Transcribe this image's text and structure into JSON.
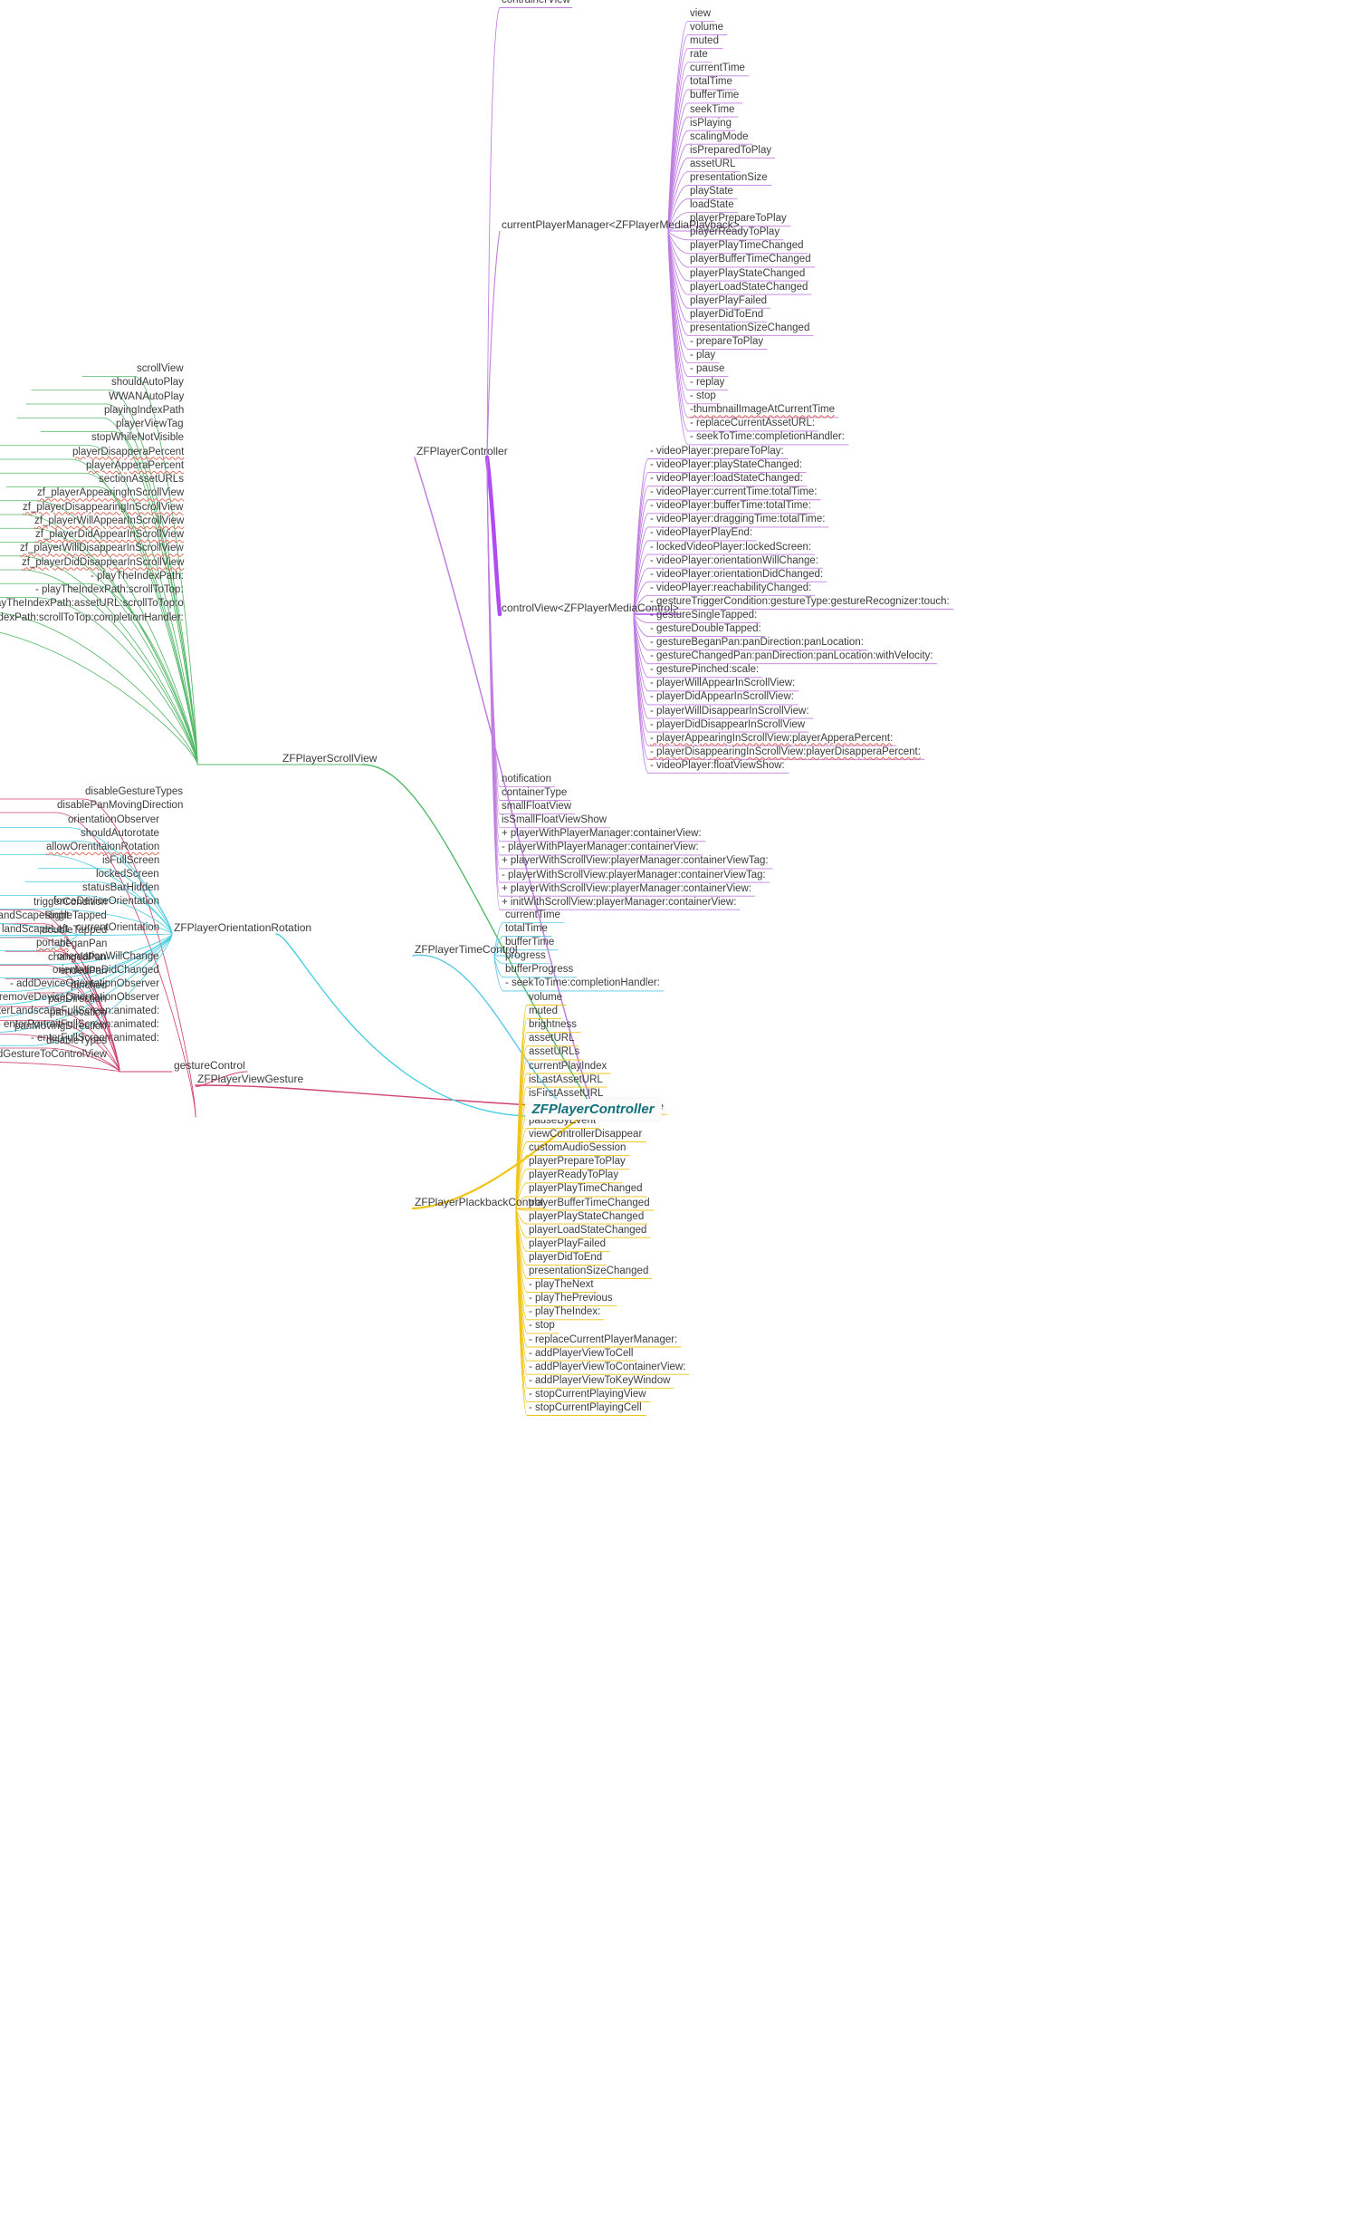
{
  "diagram": {
    "type": "mindmap",
    "title": "ZFPlayerController",
    "root": {
      "label": "ZFPlayerController",
      "color": "#11707c"
    },
    "colors": {
      "scrollview": "#55b869",
      "gesture": "#d0446f",
      "orientation": "#49cfe0",
      "manager": "#c07fe0",
      "controlview": "#a12df0",
      "timecontrol": "#5bc8e8",
      "playback": "#f0c419",
      "text": "#3c3c3c",
      "spellcheck": "#e06a5a"
    },
    "branches": [
      {
        "id": "scrollview",
        "label": "ZFPlayerScrollView",
        "color": "#55b869",
        "side": "left",
        "items": [
          {
            "label": "scrollView",
            "spell": false
          },
          {
            "label": "shouldAutoPlay",
            "spell": false
          },
          {
            "label": "WWANAutoPlay",
            "spell": false
          },
          {
            "label": "playingIndexPath",
            "spell": false
          },
          {
            "label": "playerViewTag",
            "spell": false
          },
          {
            "label": "stopWhileNotVisible",
            "spell": false
          },
          {
            "label": "playerDisapperaPercent",
            "spell": true
          },
          {
            "label": "playerApperaPercent",
            "spell": true
          },
          {
            "label": "sectionAssetURLs",
            "spell": false
          },
          {
            "label": "zf_playerAppearingInScrollView",
            "spell": true
          },
          {
            "label": "zf_playerDisappearingInScrollView",
            "spell": true
          },
          {
            "label": "zf_playerWillAppearInScrollView",
            "spell": true
          },
          {
            "label": "zf_playerDidAppearInScrollView",
            "spell": true
          },
          {
            "label": "zf_playerWillDisappearInScrollView",
            "spell": true
          },
          {
            "label": "zf_playerDidDisappearInScrollView",
            "spell": true
          },
          {
            "label": "- playTheIndexPath:",
            "spell": false
          },
          {
            "label": "- playTheIndexPath:scrollToTop:",
            "spell": false
          },
          {
            "label": "- playTheIndexPath:assetURL:scrollToTop:o",
            "spell": false
          },
          {
            "label": "- playTheIndexPath:scrollToTop:completionHandler:",
            "spell": false
          }
        ]
      },
      {
        "id": "gesture",
        "label": "ZFPlayerViewGesture",
        "color": "#d0446f",
        "side": "left",
        "subgroup": {
          "label": "gestureControl",
          "items": [
            {
              "label": "triggerCondition",
              "spell": false
            },
            {
              "label": "singleTapped",
              "spell": false
            },
            {
              "label": "doubleTapped",
              "spell": false
            },
            {
              "label": "beganPan",
              "spell": false
            },
            {
              "label": "changedPan",
              "spell": false
            },
            {
              "label": "endedPan",
              "spell": false
            },
            {
              "label": "pinched",
              "spell": false
            },
            {
              "label": "panDirection",
              "spell": false
            },
            {
              "label": "panLocation",
              "spell": false
            },
            {
              "label": "panMovingDirection",
              "spell": false
            },
            {
              "label": "disableTypes",
              "spell": false
            },
            {
              "label": "- addGestureToControlView",
              "spell": false
            }
          ]
        },
        "items": [
          {
            "label": "disableGestureTypes",
            "spell": false
          },
          {
            "label": "disablePanMovingDirection",
            "spell": false
          }
        ]
      },
      {
        "id": "orientation",
        "label": "ZFPlayerOrientationRotation",
        "color": "#49cfe0",
        "side": "left",
        "items": [
          {
            "label": "orientationObserver",
            "spell": false
          },
          {
            "label": "shouldAutorotate",
            "spell": false
          },
          {
            "label": "allowOrentitaionRotation",
            "spell": true
          },
          {
            "label": "isFullScreen",
            "spell": false
          },
          {
            "label": "lockedScreen",
            "spell": false
          },
          {
            "label": "statusBarHidden",
            "spell": false
          },
          {
            "label": "forceDeviceOrientation",
            "spell": false
          },
          {
            "label": "currentOrientation",
            "spell": false
          },
          {
            "label": "orientationWillChange",
            "spell": false
          },
          {
            "label": "orientationDidChanged",
            "spell": false
          },
          {
            "label": "- addDeviceOrientationObserver",
            "spell": false
          },
          {
            "label": "- removeDeviceOrientationObserver",
            "spell": false
          },
          {
            "label": "- enterLandscapeFullScreen:animated:",
            "spell": false
          },
          {
            "label": "- enterPortraitFullScreen:animated:",
            "spell": false
          },
          {
            "label": "- enterFullScreen:animated:",
            "spell": false
          }
        ],
        "subgroup2": {
          "label": "currentOrientation",
          "items": [
            {
              "label": "landScapeRight",
              "spell": false
            },
            {
              "label": "landScapeLeft",
              "spell": false
            },
            {
              "label": "portarit",
              "spell": true
            }
          ]
        }
      },
      {
        "id": "controller",
        "label": "ZFPlayerController",
        "color": "#c07fe0",
        "side": "right",
        "items": [
          {
            "label": "contrainerView",
            "spell": false
          }
        ],
        "managerNode": {
          "label": "currentPlayerManager<ZFPlayerMediaPlayback>",
          "items": [
            {
              "label": "view",
              "spell": false
            },
            {
              "label": "volume",
              "spell": false
            },
            {
              "label": "muted",
              "spell": false
            },
            {
              "label": "rate",
              "spell": false
            },
            {
              "label": "currentTime",
              "spell": false
            },
            {
              "label": "totalTime",
              "spell": false
            },
            {
              "label": "bufferTime",
              "spell": false
            },
            {
              "label": "seekTime",
              "spell": false
            },
            {
              "label": "isPlaying",
              "spell": false
            },
            {
              "label": "scalingMode",
              "spell": false
            },
            {
              "label": "isPreparedToPlay",
              "spell": false
            },
            {
              "label": "assetURL",
              "spell": false
            },
            {
              "label": "presentationSize",
              "spell": false
            },
            {
              "label": "playState",
              "spell": false
            },
            {
              "label": "loadState",
              "spell": false
            },
            {
              "label": "playerPrepareToPlay",
              "spell": false
            },
            {
              "label": "playerReadyToPlay",
              "spell": false
            },
            {
              "label": "playerPlayTimeChanged",
              "spell": false
            },
            {
              "label": "playerBufferTimeChanged",
              "spell": false
            },
            {
              "label": "playerPlayStateChanged",
              "spell": false
            },
            {
              "label": "playerLoadStateChanged",
              "spell": false
            },
            {
              "label": "playerPlayFailed",
              "spell": false
            },
            {
              "label": "playerDidToEnd",
              "spell": false
            },
            {
              "label": "presentationSizeChanged",
              "spell": false
            },
            {
              "label": "- prepareToPlay",
              "spell": false
            },
            {
              "label": "- play",
              "spell": false
            },
            {
              "label": "- pause",
              "spell": false
            },
            {
              "label": "- replay",
              "spell": false
            },
            {
              "label": "- stop",
              "spell": false
            },
            {
              "label": "-thumbnailImageAtCurrentTime",
              "spell": true
            },
            {
              "label": "- replaceCurrentAssetURL:",
              "spell": false
            },
            {
              "label": "- seekToTime:completionHandler:",
              "spell": false
            }
          ]
        },
        "controlNode": {
          "label": "controlView<ZFPlayerMediaControl>",
          "items": [
            {
              "label": "- videoPlayer:prepareToPlay:",
              "spell": false
            },
            {
              "label": "- videoPlayer:playStateChanged:",
              "spell": false
            },
            {
              "label": "- videoPlayer:loadStateChanged:",
              "spell": false
            },
            {
              "label": "- videoPlayer:currentTime:totalTime:",
              "spell": false
            },
            {
              "label": "- videoPlayer:bufferTime:totalTime:",
              "spell": false
            },
            {
              "label": "- videoPlayer:draggingTime:totalTime:",
              "spell": false
            },
            {
              "label": "- videoPlayerPlayEnd:",
              "spell": false
            },
            {
              "label": "- lockedVideoPlayer:lockedScreen:",
              "spell": false
            },
            {
              "label": "- videoPlayer:orientationWillChange:",
              "spell": false
            },
            {
              "label": "- videoPlayer:orientationDidChanged:",
              "spell": false
            },
            {
              "label": "- videoPlayer:reachabilityChanged:",
              "spell": false
            },
            {
              "label": "- gestureTriggerCondition:gestureType:gestureRecognizer:touch:",
              "spell": false
            },
            {
              "label": "- gestureSingleTapped:",
              "spell": false
            },
            {
              "label": "- gestureDoubleTapped:",
              "spell": false
            },
            {
              "label": "- gestureBeganPan:panDirection:panLocation:",
              "spell": false
            },
            {
              "label": "- gestureChangedPan:panDirection:panLocation:withVelocity:",
              "spell": false
            },
            {
              "label": "- gesturePinched:scale:",
              "spell": false
            },
            {
              "label": "- playerWillAppearInScrollView:",
              "spell": false
            },
            {
              "label": "- playerDidAppearInScrollView:",
              "spell": false
            },
            {
              "label": "- playerWillDisappearInScrollView:",
              "spell": false
            },
            {
              "label": "- playerDidDisappearInScrollView",
              "spell": false
            },
            {
              "label": "- playerAppearingInScrollView:playerApperaPercent:",
              "spell": true
            },
            {
              "label": "- playerDisappearingInScrollView:playerDisapperaPercent:",
              "spell": true
            },
            {
              "label": "- videoPlayer:floatViewShow:",
              "spell": false
            }
          ]
        },
        "tailItems": [
          {
            "label": "notification",
            "spell": false
          },
          {
            "label": "containerType",
            "spell": false
          },
          {
            "label": "smallFloatView",
            "spell": false
          },
          {
            "label": "isSmallFloatViewShow",
            "spell": false
          },
          {
            "label": "+ playerWithPlayerManager:containerView:",
            "spell": false
          },
          {
            "label": "- playerWithPlayerManager:containerView:",
            "spell": false
          },
          {
            "label": "+ playerWithScrollView:playerManager:containerViewTag:",
            "spell": false
          },
          {
            "label": "- playerWithScrollView:playerManager:containerViewTag:",
            "spell": false
          },
          {
            "label": "+ playerWithScrollView:playerManager:containerView:",
            "spell": false
          },
          {
            "label": "+ initWithScrollView:playerManager:containerView:",
            "spell": false
          }
        ]
      },
      {
        "id": "timecontrol",
        "label": "ZFPlayerTimeControl",
        "color": "#5bc8e8",
        "side": "right",
        "items": [
          {
            "label": "currentTime",
            "spell": false
          },
          {
            "label": "totalTime",
            "spell": false
          },
          {
            "label": "bufferTime",
            "spell": false
          },
          {
            "label": "progress",
            "spell": false
          },
          {
            "label": "bufferProgress",
            "spell": false
          },
          {
            "label": "- seekToTime:completionHandler:",
            "spell": false
          }
        ]
      },
      {
        "id": "playback",
        "label": "ZFPlayerPlackbackControl",
        "color": "#f0c419",
        "side": "right",
        "items": [
          {
            "label": "volume",
            "spell": false
          },
          {
            "label": "muted",
            "spell": false
          },
          {
            "label": "brightness",
            "spell": false
          },
          {
            "label": "assetURL",
            "spell": false
          },
          {
            "label": "assetURLs",
            "spell": false
          },
          {
            "label": "currentPlayIndex",
            "spell": false
          },
          {
            "label": "isLastAssetURL",
            "spell": false
          },
          {
            "label": "isFirstAssetURL",
            "spell": false
          },
          {
            "label": "pauseWhenAppResignActive",
            "spell": false
          },
          {
            "label": "pauseByEvent",
            "spell": false
          },
          {
            "label": "viewControllerDisappear",
            "spell": false
          },
          {
            "label": "customAudioSession",
            "spell": false
          },
          {
            "label": "playerPrepareToPlay",
            "spell": false
          },
          {
            "label": "playerReadyToPlay",
            "spell": false
          },
          {
            "label": "playerPlayTimeChanged",
            "spell": false
          },
          {
            "label": "playerBufferTimeChanged",
            "spell": false
          },
          {
            "label": "playerPlayStateChanged",
            "spell": false
          },
          {
            "label": "playerLoadStateChanged",
            "spell": false
          },
          {
            "label": "playerPlayFailed",
            "spell": false
          },
          {
            "label": "playerDidToEnd",
            "spell": false
          },
          {
            "label": "presentationSizeChanged",
            "spell": false
          },
          {
            "label": "- playTheNext",
            "spell": false
          },
          {
            "label": "- playThePrevious",
            "spell": false
          },
          {
            "label": "- playTheIndex:",
            "spell": false
          },
          {
            "label": "- stop",
            "spell": false
          },
          {
            "label": "- replaceCurrentPlayerManager:",
            "spell": false
          },
          {
            "label": "- addPlayerViewToCell",
            "spell": false
          },
          {
            "label": "- addPlayerViewToContainerView:",
            "spell": false
          },
          {
            "label": "- addPlayerViewToKeyWindow",
            "spell": false
          },
          {
            "label": "- stopCurrentPlayingView",
            "spell": false
          },
          {
            "label": "- stopCurrentPlayingCell",
            "spell": false
          }
        ]
      }
    ]
  }
}
